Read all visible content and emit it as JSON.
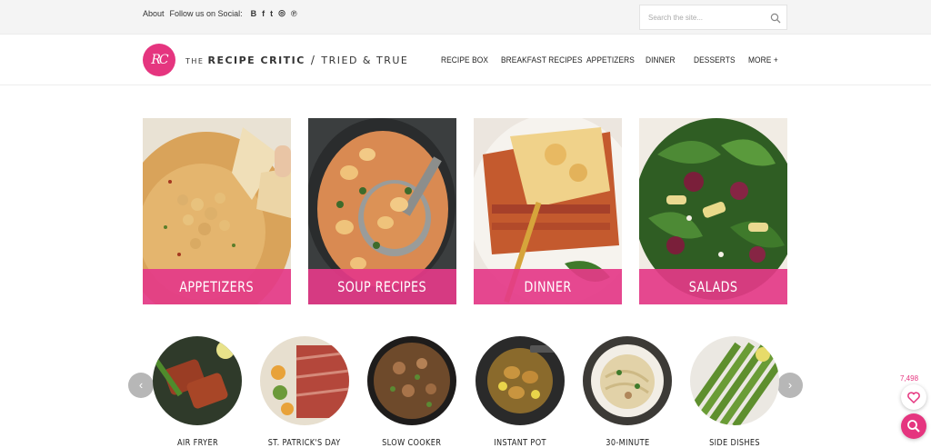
{
  "topbar": {
    "about": "About",
    "follow": "Follow us on Social:",
    "social_icons": [
      "blogger-icon",
      "facebook-icon",
      "twitter-icon",
      "instagram-icon",
      "pinterest-icon"
    ],
    "social_glyphs": [
      "B",
      "f",
      "t",
      "◎",
      "℗"
    ],
    "search_placeholder": "Search the site..."
  },
  "header": {
    "logo_mark": "RC",
    "logo_the": "THE",
    "logo_name": "RECIPE CRITIC",
    "logo_slash": "/",
    "logo_tagline": "TRIED & TRUE",
    "nav": [
      "RECIPE BOX",
      "BREAKFAST RECIPES",
      "APPETIZERS",
      "DINNER",
      "DESSERTS",
      "MORE +"
    ]
  },
  "tiles": [
    "APPETIZERS",
    "SOUP RECIPES",
    "DINNER",
    "SALADS"
  ],
  "circles": [
    "AIR FRYER",
    "ST. PATRICK'S DAY",
    "SLOW COOKER",
    "INSTANT POT",
    "30-MINUTE",
    "SIDE DISHES"
  ],
  "carousel": {
    "prev": "‹",
    "next": "›"
  },
  "widgets": {
    "favorites_count": "7,498"
  },
  "colors": {
    "brand": "#e5357f",
    "tile_overlay": "#e43a88",
    "arrow": "#b7b7b7"
  }
}
